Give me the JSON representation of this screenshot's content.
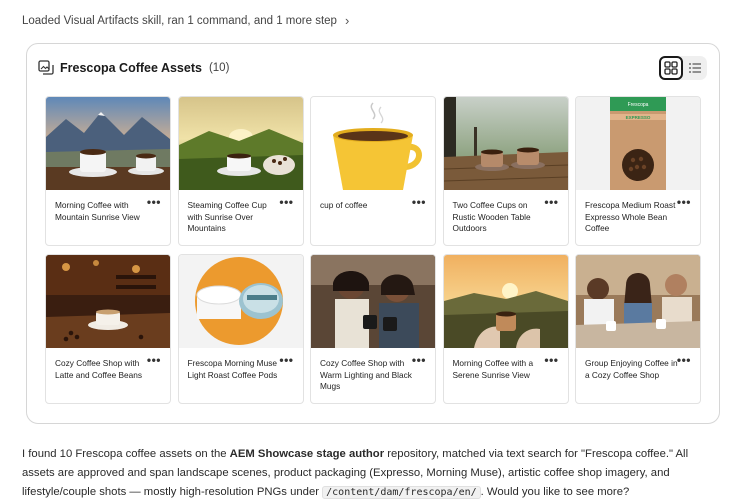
{
  "status_line": {
    "text": "Loaded Visual Artifacts skill, ran 1 command, and 1 more step",
    "chevron": "chevron-right-icon"
  },
  "panel": {
    "title": "Frescopa Coffee Assets",
    "count": "(10)",
    "header_icon": "assets-icon",
    "view_toggle": {
      "grid_icon": "grid-view-icon",
      "list_icon": "list-view-icon",
      "active": "grid"
    }
  },
  "assets": [
    {
      "title": "Morning Coffee with Mountain Sunrise View",
      "more": "•••"
    },
    {
      "title": "Steaming Coffee Cup with Sunrise Over Mountains",
      "more": "•••"
    },
    {
      "title": "cup of coffee",
      "more": "•••"
    },
    {
      "title": "Two Coffee Cups on Rustic Wooden Table Outdoors",
      "more": "•••"
    },
    {
      "title": "Frescopa Medium Roast Expresso Whole Bean Coffee",
      "more": "•••",
      "label_brand": "Frescopa",
      "label_product": "EXPRESSO"
    },
    {
      "title": "Cozy Coffee Shop with Latte and Coffee Beans",
      "more": "•••"
    },
    {
      "title": "Frescopa Morning Muse Light Roast Coffee Pods",
      "more": "•••"
    },
    {
      "title": "Cozy Coffee Shop with Warm Lighting and Black Mugs",
      "more": "•••"
    },
    {
      "title": "Morning Coffee with a Serene Sunrise View",
      "more": "•••"
    },
    {
      "title": "Group Enjoying Coffee in a Cozy Coffee Shop",
      "more": "•••"
    }
  ],
  "answer": {
    "p1": "I found 10 Frescopa coffee assets on the ",
    "bold": "AEM Showcase stage author",
    "p2": " repository, matched via text search for \"Frescopa coffee.\" All assets are approved and span landscape scenes, product packaging (Expresso, Morning Muse), artistic coffee shop imagery, and lifestyle/couple shots — mostly high-resolution PNGs under ",
    "code": "/content/dam/frescopa/en/",
    "p3": ". Would you like to see more?"
  }
}
